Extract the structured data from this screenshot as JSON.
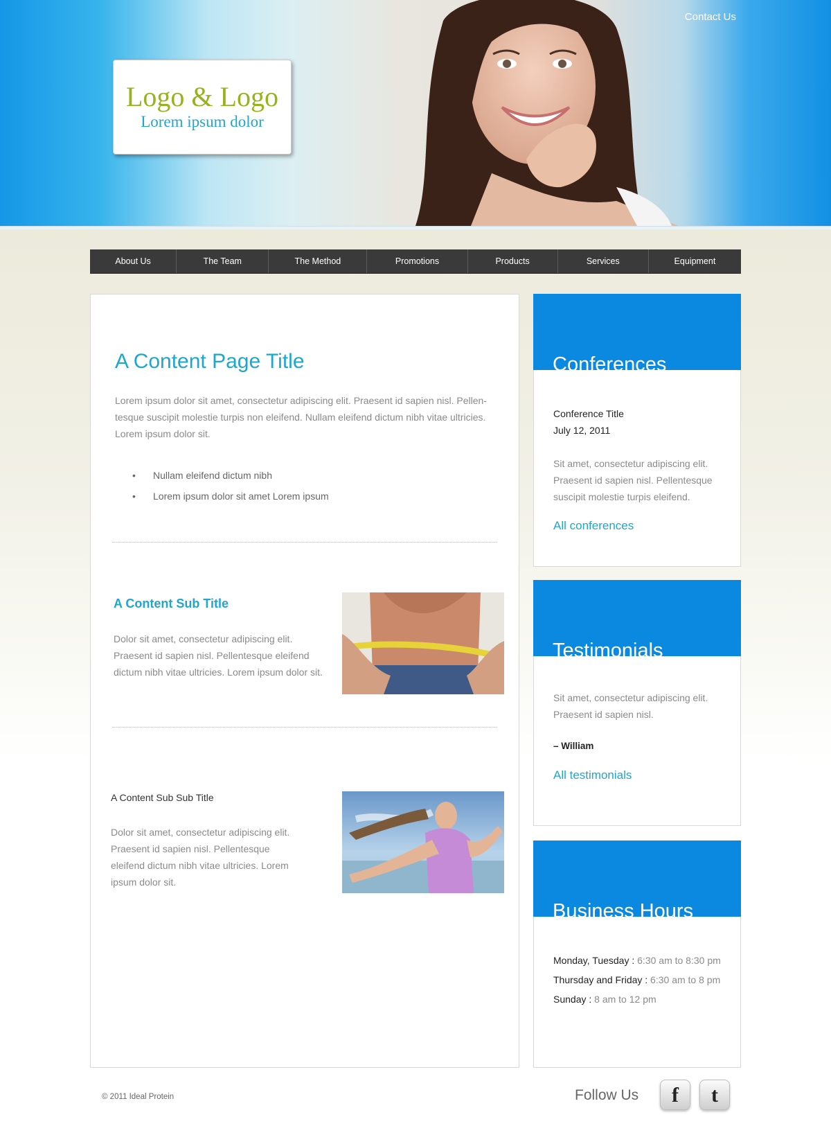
{
  "header": {
    "contact_link": "Contact Us",
    "logo_title": "Logo & Logo",
    "logo_subtitle": "Lorem ipsum dolor"
  },
  "nav": {
    "items": [
      "About Us",
      "The Team",
      "The Method",
      "Promotions",
      "Products",
      "Services",
      "Equipment"
    ]
  },
  "main": {
    "title": "A Content Page Title",
    "intro": "Lorem ipsum dolor sit amet, consectetur adipiscing elit. Praesent id sapien nisl. Pellen-tesque suscipit molestie turpis non eleifend. Nullam eleifend dictum nibh vitae ultricies. Lorem ipsum dolor sit.",
    "bullets": [
      "Nullam eleifend dictum nibh",
      "Lorem ipsum dolor sit amet Lorem ipsum"
    ],
    "sub_title": "A Content Sub Title",
    "sub_text": "Dolor sit amet, consectetur adipiscing elit. Praesent id sapien nisl. Pellentesque eleifend dictum nibh vitae ultricies. Lorem ipsum dolor sit.",
    "subsub_title": "A Content Sub Sub Title",
    "subsub_text": "Dolor sit amet, consectetur adipiscing elit. Praesent id sapien nisl. Pellentesque eleifend dictum nibh vitae ultricies. Lorem ipsum dolor sit."
  },
  "sidebar": {
    "conferences": {
      "title": "Conferences",
      "item_title": "Conference Title",
      "item_date": "July 12, 2011",
      "item_text": "Sit amet, consectetur adipiscing elit. Praesent id sapien nisl. Pellentesque suscipit molestie turpis eleifend.",
      "link": "All conferences"
    },
    "testimonials": {
      "title": "Testimonials",
      "text": "Sit amet, consectetur adipiscing elit. Praesent id sapien nisl.",
      "author": "– William",
      "link": "All testimonials"
    },
    "hours": {
      "title": "Business Hours",
      "rows": [
        {
          "days": "Monday, Tuesday :",
          "time": " 6:30 am to 8:30 pm"
        },
        {
          "days": "Thursday and Friday :",
          "time": " 6:30 am to 8 pm"
        },
        {
          "days": "Sunday :",
          "time": " 8 am to 12 pm"
        }
      ]
    }
  },
  "footer": {
    "copyright": "© 2011 Ideal Protein",
    "follow": "Follow Us",
    "social_icons": [
      "facebook-icon",
      "twitter-icon"
    ]
  },
  "colors": {
    "accent_blue": "#0b88e0",
    "title_blue": "#1fa6cf",
    "logo_green": "#95b41b",
    "nav_bg": "#3a3a3a"
  }
}
